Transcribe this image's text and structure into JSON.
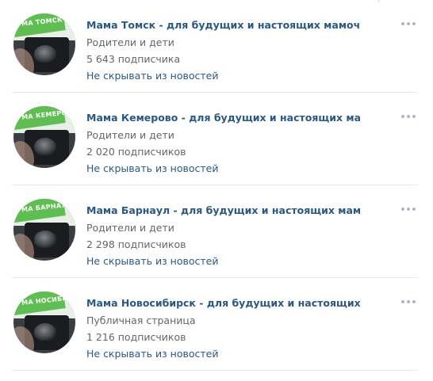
{
  "communities": [
    {
      "title": "Мама Томск - для будущих и настоящих мамочек",
      "category": "Родители и дети",
      "subscribers": "5 643 подписчика",
      "action": "Не скрывать из новостей",
      "avatar_text": "МА ТОМСК"
    },
    {
      "title": "Мама Кемерово - для будущих и настоящих мамочек",
      "category": "Родители и дети",
      "subscribers": "2 020 подписчиков",
      "action": "Не скрывать из новостей",
      "avatar_text": "МА КЕМЕРОВО"
    },
    {
      "title": "Мама Барнаул - для будущих и настоящих мамочек",
      "category": "Родители и дети",
      "subscribers": "2 298 подписчиков",
      "action": "Не скрывать из новостей",
      "avatar_text": "МА БАРНАУЛ"
    },
    {
      "title": "Мама Новосибирск - для будущих и настоящих мамоч",
      "category": "Публичная страница",
      "subscribers": "1 216 подписчиков",
      "action": "Не скрывать из новостей",
      "avatar_text": "МА НОСИБИРСК"
    }
  ],
  "colors": {
    "link": "#2a5885",
    "secondary_text": "#656565",
    "divider": "#e7e8ec",
    "more_dots": "#aab7c6"
  },
  "icons": {
    "more": "more-dots-icon"
  }
}
